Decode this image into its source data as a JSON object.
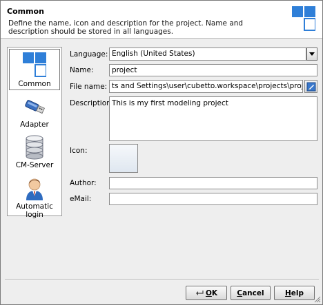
{
  "header": {
    "title": "Common",
    "description": "Define the name, icon and description for the project. Name and description should be stored in all languages."
  },
  "sidebar": {
    "items": [
      {
        "label": "Common",
        "icon": "common-icon",
        "selected": true
      },
      {
        "label": "Adapter",
        "icon": "usb-adapter-icon",
        "selected": false
      },
      {
        "label": "CM-Server",
        "icon": "database-icon",
        "selected": false
      },
      {
        "label": "Automatic login",
        "icon": "user-icon",
        "selected": false
      }
    ]
  },
  "form": {
    "language": {
      "label": "Language:",
      "value": "English (United States)"
    },
    "name": {
      "label": "Name:",
      "value": "project"
    },
    "file_name": {
      "label": "File name:",
      "value": "ts and Settings\\user\\cubetto.workspace\\projects\\project\\project.etp"
    },
    "description": {
      "label": "Description:",
      "value": "This is my first modeling project"
    },
    "icon": {
      "label": "Icon:"
    },
    "author": {
      "label": "Author:",
      "value": ""
    },
    "email": {
      "label": "eMail:",
      "value": ""
    }
  },
  "buttons": {
    "ok": {
      "mnemonic": "O",
      "rest": "K",
      "icon": "ok-return-icon"
    },
    "cancel": {
      "mnemonic": "C",
      "rest": "ancel"
    },
    "help": {
      "mnemonic": "H",
      "rest": "elp"
    }
  },
  "colors": {
    "accent_blue": "#2f7fd8",
    "header_bg": "#ffffff",
    "dialog_bg": "#eeeeee"
  }
}
